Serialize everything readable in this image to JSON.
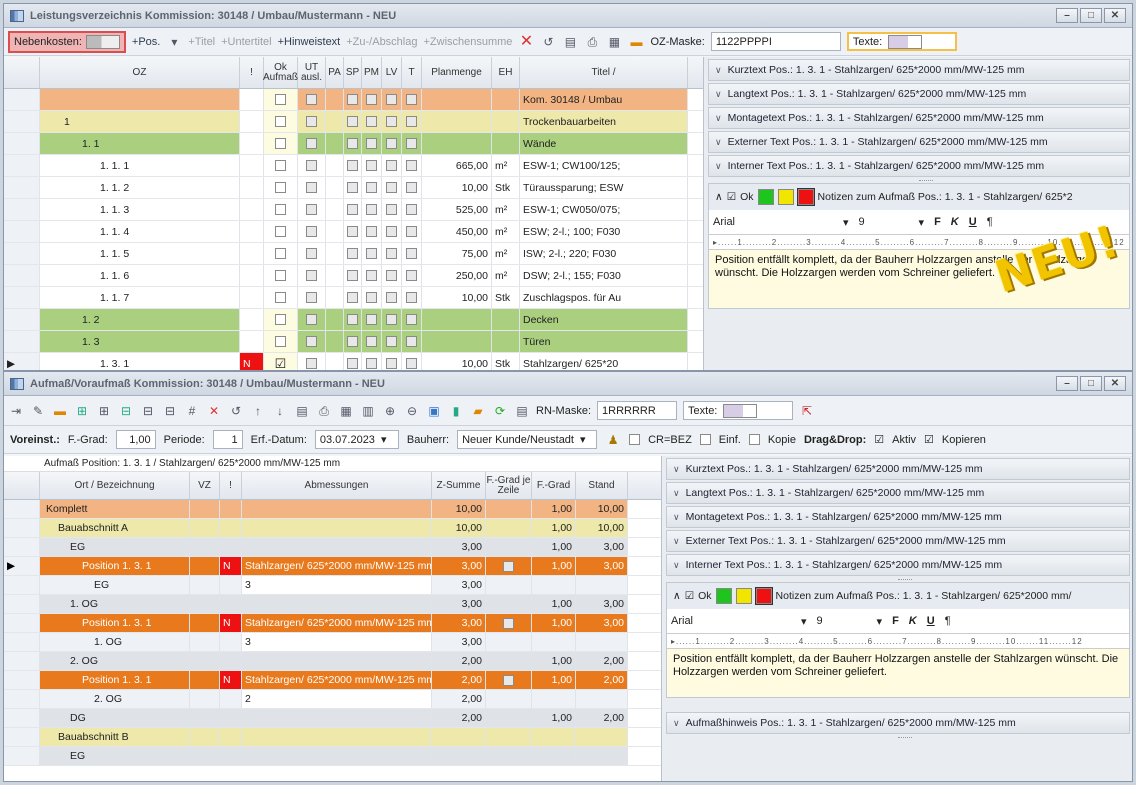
{
  "win1": {
    "title": "Leistungsverzeichnis Kommission: 30148 / Umbau/Mustermann - NEU",
    "toolbar": {
      "nebenkosten": "Nebenkosten:",
      "pos": "+Pos.",
      "titel": "+Titel",
      "untertitel": "+Untertitel",
      "hinweistext": "+Hinweistext",
      "zuab": "+Zu-/Abschlag",
      "zwischensumme": "+Zwischensumme",
      "ozmaske_label": "OZ-Maske:",
      "ozmaske_value": "1122PPPPI",
      "texte_label": "Texte:"
    },
    "columns": [
      "OZ",
      "!",
      "Ok Aufmaß",
      "UT ausl.",
      "PA",
      "SP",
      "PM",
      "LV",
      "T",
      "Planmenge",
      "EH",
      "Titel /"
    ],
    "rows": [
      {
        "oz": "",
        "menge": "",
        "eh": "",
        "text": "Kom. 30148 / Umbau"
      },
      {
        "oz": "1",
        "menge": "",
        "eh": "",
        "text": "Trockenbauarbeiten"
      },
      {
        "oz": "1. 1",
        "menge": "",
        "eh": "",
        "text": "Wände"
      },
      {
        "oz": "1. 1.  1",
        "menge": "665,00",
        "eh": "m²",
        "text": "ESW-1; CW100/125;"
      },
      {
        "oz": "1. 1.  2",
        "menge": "10,00",
        "eh": "Stk",
        "text": "Türaussparung; ESW"
      },
      {
        "oz": "1. 1.  3",
        "menge": "525,00",
        "eh": "m²",
        "text": "ESW-1; CW050/075;"
      },
      {
        "oz": "1. 1.  4",
        "menge": "450,00",
        "eh": "m²",
        "text": "ESW; 2-l.; 100; F030"
      },
      {
        "oz": "1. 1.  5",
        "menge": "75,00",
        "eh": "m²",
        "text": "ISW; 2-l.; 220; F030"
      },
      {
        "oz": "1. 1.  6",
        "menge": "250,00",
        "eh": "m²",
        "text": "DSW; 2-l.; 155; F030"
      },
      {
        "oz": "1. 1.  7",
        "menge": "10,00",
        "eh": "Stk",
        "text": "Zuschlagspos. für Au"
      },
      {
        "oz": "1. 2",
        "menge": "",
        "eh": "",
        "text": "Decken"
      },
      {
        "oz": "1. 3",
        "menge": "",
        "eh": "",
        "text": "Türen"
      },
      {
        "oz": "1. 3.  1",
        "menge": "10,00",
        "eh": "Stk",
        "text": "Stahlzargen/ 625*20",
        "flag": "N"
      }
    ],
    "acc": [
      "Kurztext Pos.:  1. 3.  1  - Stahlzargen/ 625*2000 mm/MW-125 mm",
      "Langtext Pos.:  1. 3.  1  - Stahlzargen/ 625*2000 mm/MW-125 mm",
      "Montagetext Pos.:  1. 3.  1  - Stahlzargen/ 625*2000 mm/MW-125 mm",
      "Externer Text Pos.:  1. 3.  1  - Stahlzargen/ 625*2000 mm/MW-125 mm",
      "Interner Text Pos.:  1. 3.  1  - Stahlzargen/ 625*2000 mm/MW-125 mm"
    ],
    "notes": {
      "ok": "Ok",
      "title": "Notizen zum Aufmaß Pos.:  1. 3.  1  - Stahlzargen/ 625*2",
      "font": "Arial",
      "size": "9",
      "text": "Position entfällt komplett, da der Bauherr Holzzargen anstelle der Stahlzargen wünscht. Die Holzzargen werden vom Schreiner geliefert."
    },
    "badge": "NEU!"
  },
  "win2": {
    "title": "Aufmaß/Voraufmaß Kommission: 30148 / Umbau/Mustermann - NEU",
    "toolbar": {
      "rnmaske_label": "RN-Maske:",
      "rnmaske_value": "1RRRRRR",
      "texte_label": "Texte:"
    },
    "form": {
      "voreinst": "Voreinst.:",
      "fgrad_label": "F.-Grad:",
      "fgrad": "1,00",
      "periode_label": "Periode:",
      "periode": "1",
      "erf_label": "Erf.-Datum:",
      "erf": "03.07.2023",
      "bauherr_label": "Bauherr:",
      "bauherr": "Neuer Kunde/Neustadt",
      "crbez": "CR=BEZ",
      "einf": "Einf.",
      "kopie": "Kopie",
      "dd": "Drag&Drop:",
      "aktiv": "Aktiv",
      "kopieren": "Kopieren"
    },
    "subtitle": "Aufmaß Position:  1. 3.  1 / Stahlzargen/ 625*2000 mm/MW-125 mm",
    "columns": [
      "Ort / Bezeichnung",
      "VZ",
      "!",
      "Abmessungen",
      "Z-Summe",
      "F.-Grad je Zeile",
      "F.-Grad",
      "Stand"
    ],
    "rows": [
      {
        "ort": "Komplett",
        "abm": "",
        "z": "10,00",
        "fg": "1,00",
        "st": "10,00"
      },
      {
        "ort": "Bauabschnitt A",
        "abm": "",
        "z": "10,00",
        "fg": "1,00",
        "st": "10,00"
      },
      {
        "ort": "EG",
        "abm": "",
        "z": "3,00",
        "fg": "1,00",
        "st": "3,00"
      },
      {
        "ort": "Position  1. 3.  1",
        "abm": "Stahlzargen/ 625*2000 mm/MW-125 mm",
        "z": "3,00",
        "fg": "1,00",
        "st": "3,00",
        "flag": "N"
      },
      {
        "ort": "EG",
        "abm": "3",
        "z": "3,00",
        "fg": "",
        "st": ""
      },
      {
        "ort": "1. OG",
        "abm": "",
        "z": "3,00",
        "fg": "1,00",
        "st": "3,00"
      },
      {
        "ort": "Position  1. 3.  1",
        "abm": "Stahlzargen/ 625*2000 mm/MW-125 mm",
        "z": "3,00",
        "fg": "1,00",
        "st": "3,00",
        "flag": "N"
      },
      {
        "ort": "1. OG",
        "abm": "3",
        "z": "3,00",
        "fg": "",
        "st": ""
      },
      {
        "ort": "2. OG",
        "abm": "",
        "z": "2,00",
        "fg": "1,00",
        "st": "2,00"
      },
      {
        "ort": "Position  1. 3.  1",
        "abm": "Stahlzargen/ 625*2000 mm/MW-125 mm",
        "z": "2,00",
        "fg": "1,00",
        "st": "2,00",
        "flag": "N"
      },
      {
        "ort": "2. OG",
        "abm": "2",
        "z": "2,00",
        "fg": "",
        "st": ""
      },
      {
        "ort": "DG",
        "abm": "",
        "z": "2,00",
        "fg": "1,00",
        "st": "2,00"
      },
      {
        "ort": "Bauabschnitt B",
        "abm": "",
        "z": "",
        "fg": "",
        "st": ""
      },
      {
        "ort": "EG",
        "abm": "",
        "z": "",
        "fg": "",
        "st": ""
      }
    ],
    "acc": [
      "Kurztext Pos.:  1. 3.  1  - Stahlzargen/ 625*2000 mm/MW-125 mm",
      "Langtext Pos.:  1. 3.  1  - Stahlzargen/ 625*2000 mm/MW-125 mm",
      "Montagetext Pos.:  1. 3.  1  - Stahlzargen/ 625*2000 mm/MW-125 mm",
      "Externer Text Pos.:  1. 3.  1  - Stahlzargen/ 625*2000 mm/MW-125 mm",
      "Interner Text Pos.:  1. 3.  1  - Stahlzargen/ 625*2000 mm/MW-125 mm"
    ],
    "notes": {
      "ok": "Ok",
      "title": "Notizen zum Aufmaß Pos.:  1. 3.  1  - Stahlzargen/ 625*2000 mm/",
      "font": "Arial",
      "size": "9",
      "text": "Position entfällt komplett, da der Bauherr Holzzargen anstelle der Stahlzargen wünscht. Die Holzzargen werden vom Schreiner geliefert."
    },
    "acc_last": "Aufmaßhinweis Pos.:  1. 3.  1  - Stahlzargen/ 625*2000 mm/MW-125 mm"
  },
  "colors": {
    "orange": "#f2b482",
    "yellow": "#eee8aa",
    "green": "#a9cf7f",
    "darkorange": "#e8791c",
    "red": "#ee1111"
  }
}
